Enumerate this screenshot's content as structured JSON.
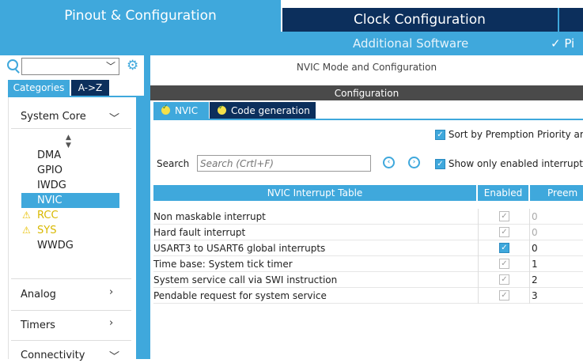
{
  "top_tabs": {
    "pinout": "Pinout & Configuration",
    "clock": "Clock Configuration"
  },
  "subbar": {
    "additional_software": "Additional Software",
    "pinout_short": "✓ Pi"
  },
  "left_panel": {
    "search_value": "",
    "tab_categories": "Categories",
    "tab_az": "A->Z",
    "system_core": "System Core",
    "items": [
      {
        "label": "DMA",
        "warning": false
      },
      {
        "label": "GPIO",
        "warning": false
      },
      {
        "label": "IWDG",
        "warning": false
      },
      {
        "label": "NVIC",
        "warning": false,
        "selected": true
      },
      {
        "label": "RCC",
        "warning": true
      },
      {
        "label": "SYS",
        "warning": true
      },
      {
        "label": "WWDG",
        "warning": false
      }
    ],
    "analog": "Analog",
    "timers": "Timers",
    "connectivity": "Connectivity"
  },
  "main": {
    "title": "NVIC Mode and Configuration",
    "configuration": "Configuration",
    "tab_nvic": "NVIC",
    "tab_codegen": "Code generation",
    "sort_option": "Sort by Premption Priority ar",
    "show_enabled_option": "Show only enabled interrupts",
    "search_label": "Search",
    "search_placeholder": "Search (Crtl+F)",
    "table": {
      "headers": [
        "NVIC Interrupt Table",
        "Enabled",
        "Preem"
      ],
      "rows": [
        {
          "name": "Non maskable interrupt",
          "enabled": true,
          "locked": true,
          "priority": "0"
        },
        {
          "name": "Hard fault interrupt",
          "enabled": true,
          "locked": true,
          "priority": "0"
        },
        {
          "name": "USART3 to USART6 global interrupts",
          "enabled": true,
          "locked": false,
          "priority": "0"
        },
        {
          "name": "Time base: System tick timer",
          "enabled": true,
          "locked": true,
          "priority": "1"
        },
        {
          "name": "System service call via SWI instruction",
          "enabled": true,
          "locked": true,
          "priority": "2"
        },
        {
          "name": "Pendable request for system service",
          "enabled": true,
          "locked": true,
          "priority": "3"
        }
      ]
    }
  },
  "colors": {
    "accent": "#3fa8dc",
    "dark": "#0c2f5c",
    "warning": "#e8c000"
  }
}
